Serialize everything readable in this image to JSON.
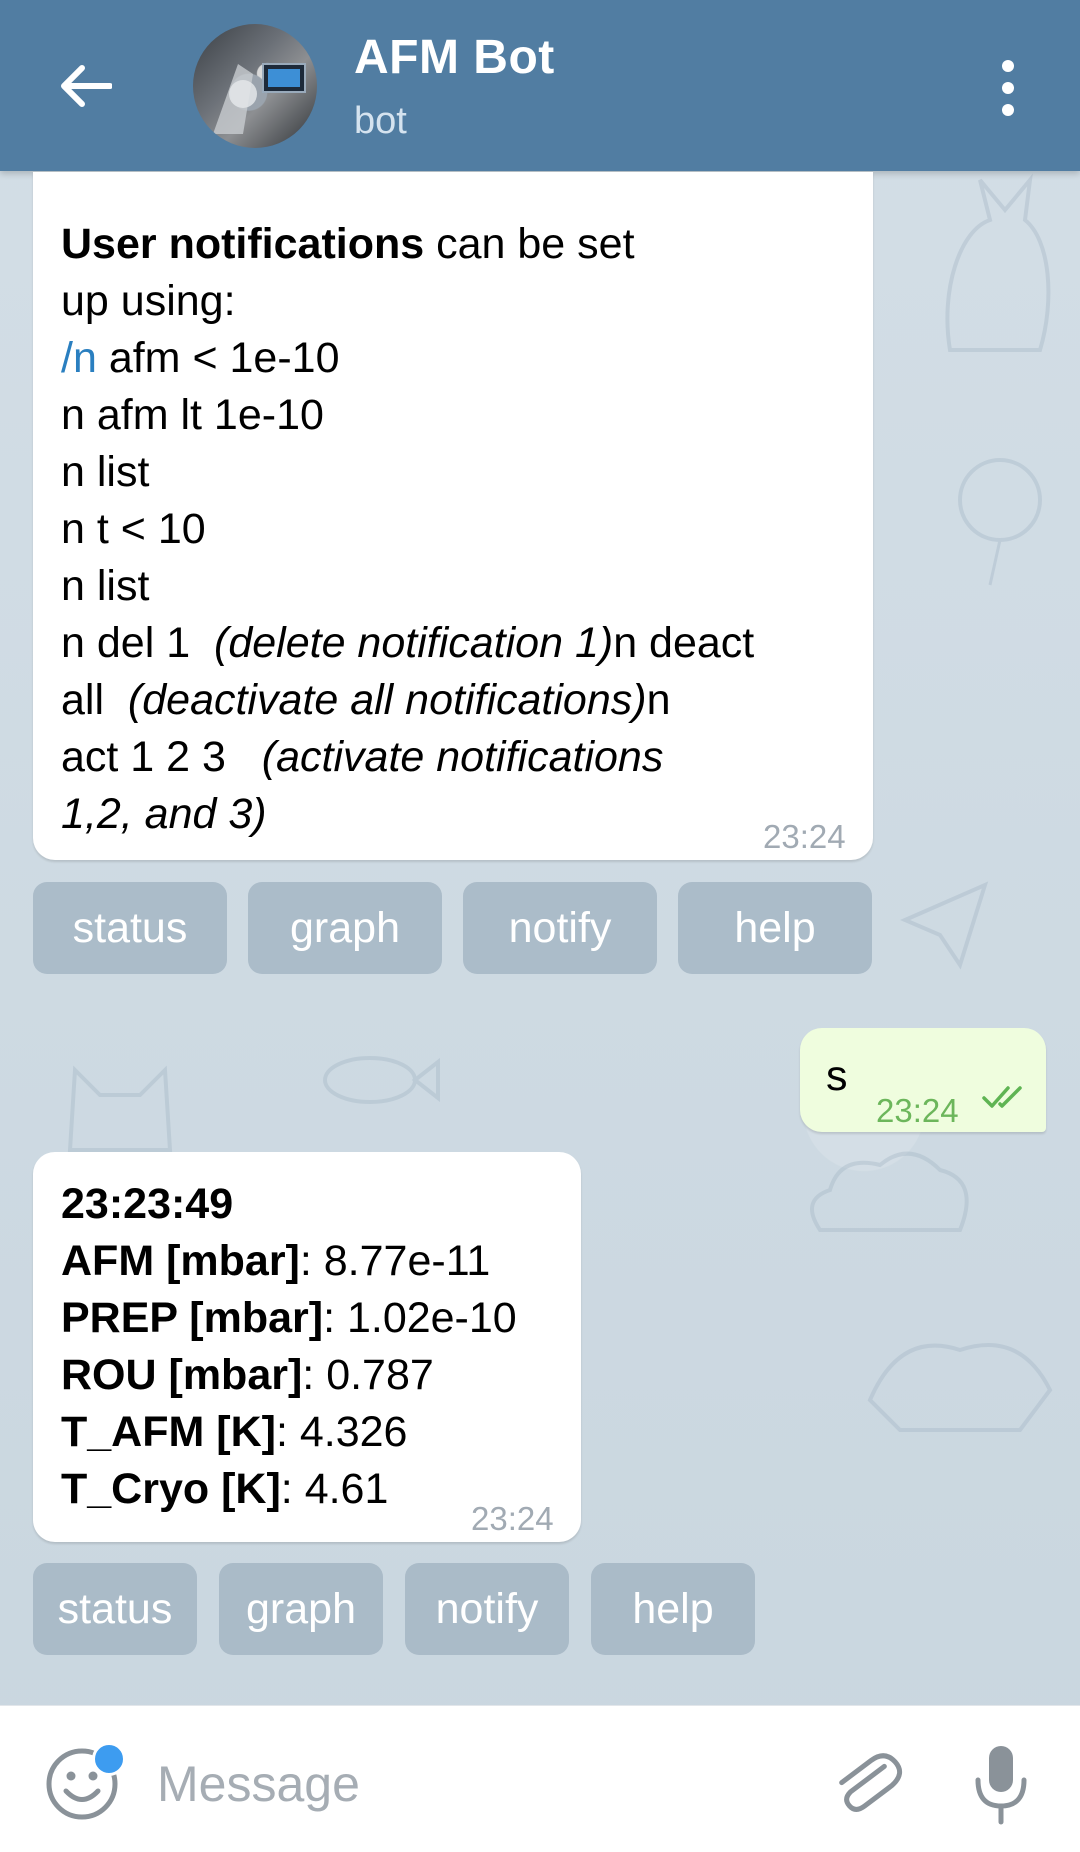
{
  "header": {
    "title": "AFM Bot",
    "subtitle": "bot",
    "back_icon": "arrow-left-icon",
    "menu_icon": "more-vertical-icon",
    "color": "#517da2"
  },
  "messages": {
    "help": {
      "lines": [
        {
          "bold": "User notifications",
          "rest": " can be set"
        },
        {
          "text": "up using:"
        },
        {
          "cmd": "/n",
          "rest": " afm < 1e-10"
        },
        {
          "text": "n afm lt 1e-10"
        },
        {
          "text": "n list"
        },
        {
          "text": "n t < 10"
        },
        {
          "text": "n list"
        },
        {
          "pre": "n del 1  ",
          "italic": "(delete notification 1)",
          "post": "n deact"
        },
        {
          "pre": "all  ",
          "italic": "(deactivate all notifications)",
          "post": "n"
        },
        {
          "pre": "act 1 2 3   ",
          "italic": "(activate notifications",
          "post": ""
        },
        {
          "pre": "",
          "italic": "1,2, and 3)",
          "post": ""
        }
      ],
      "time": "23:24"
    },
    "outgoing": {
      "text": "s",
      "time": "23:24",
      "status_icon": "double-check-icon"
    },
    "status": {
      "lines": [
        {
          "bold": "23:23:49",
          "rest": ""
        },
        {
          "bold": "AFM [mbar]",
          "rest": ": 8.77e-11"
        },
        {
          "bold": "PREP [mbar]",
          "rest": ": 1.02e-10"
        },
        {
          "bold": "ROU [mbar]",
          "rest": ": 0.787"
        },
        {
          "bold": "T_AFM [K]",
          "rest": ": 4.326"
        },
        {
          "bold": "T_Cryo [K]",
          "rest": ": 4.61"
        }
      ],
      "time": "23:24"
    }
  },
  "keyboard_1": [
    "status",
    "graph",
    "notify",
    "help"
  ],
  "keyboard_2": [
    "status",
    "graph",
    "notify",
    "help"
  ],
  "input": {
    "placeholder": "Message",
    "emoji_icon": "smiley-icon",
    "attach_icon": "paperclip-icon",
    "mic_icon": "microphone-icon"
  }
}
